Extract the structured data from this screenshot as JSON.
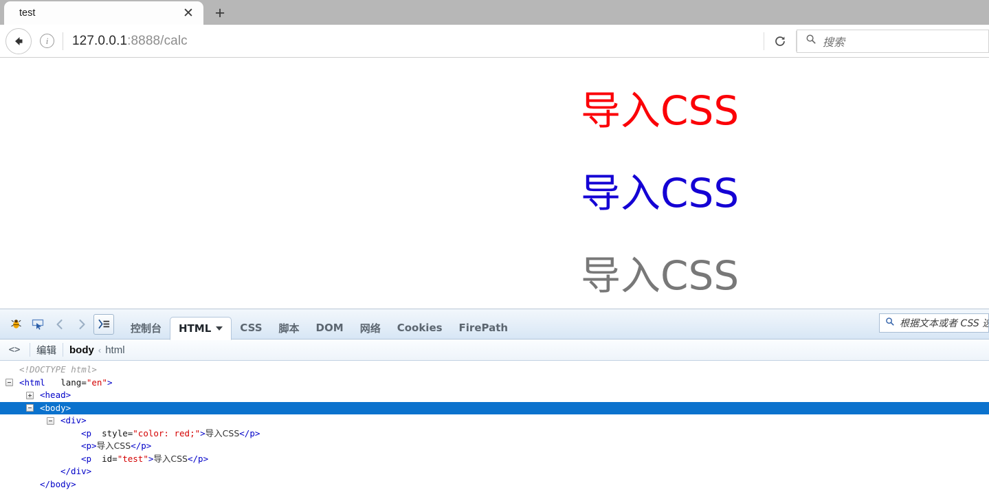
{
  "browser": {
    "tab": {
      "title": "test",
      "close_label": "✕"
    },
    "new_tab_label": "+",
    "url": {
      "host": "127.0.0.1",
      "rest": ":8888/calc"
    },
    "reload_tooltip": "reload",
    "search_placeholder": "搜索"
  },
  "page": {
    "paragraphs": [
      {
        "text": "导入CSS",
        "color": "#fb0007"
      },
      {
        "text": "导入CSS",
        "color": "#1400d4"
      },
      {
        "text": "导入CSS",
        "color": "#787878"
      }
    ]
  },
  "firebug": {
    "tabs": [
      {
        "label": "控制台",
        "active": false
      },
      {
        "label": "HTML",
        "active": true
      },
      {
        "label": "CSS",
        "active": false
      },
      {
        "label": "脚本",
        "active": false
      },
      {
        "label": "DOM",
        "active": false
      },
      {
        "label": "网络",
        "active": false
      },
      {
        "label": "Cookies",
        "active": false
      },
      {
        "label": "FirePath",
        "active": false
      }
    ],
    "search_placeholder": "根据文本或者 CSS 选",
    "breadcrumb": {
      "edit_label": "编辑",
      "nodes": [
        "body",
        "html"
      ],
      "separator": "‹"
    },
    "tree": {
      "doctype": "<!DOCTYPE html>",
      "html_open": "<html",
      "html_attr_name": "lang=",
      "html_attr_value": "\"en\"",
      "html_close_bracket": ">",
      "head": "<head>",
      "body_open": "<body>",
      "div_open": "<div>",
      "p1_open": "<p",
      "p1_attr_name": "style=",
      "p1_attr_value": "\"color: red;\"",
      "p1_gt": ">",
      "p1_text": "导入CSS",
      "p1_close": "</p>",
      "p2_open": "<p>",
      "p2_text": "导入CSS",
      "p2_close": "</p>",
      "p3_open": "<p",
      "p3_attr_name": "id=",
      "p3_attr_value": "\"test\"",
      "p3_gt": ">",
      "p3_text": "导入CSS",
      "p3_close": "</p>",
      "div_close": "</div>",
      "body_close": "</body>"
    }
  }
}
